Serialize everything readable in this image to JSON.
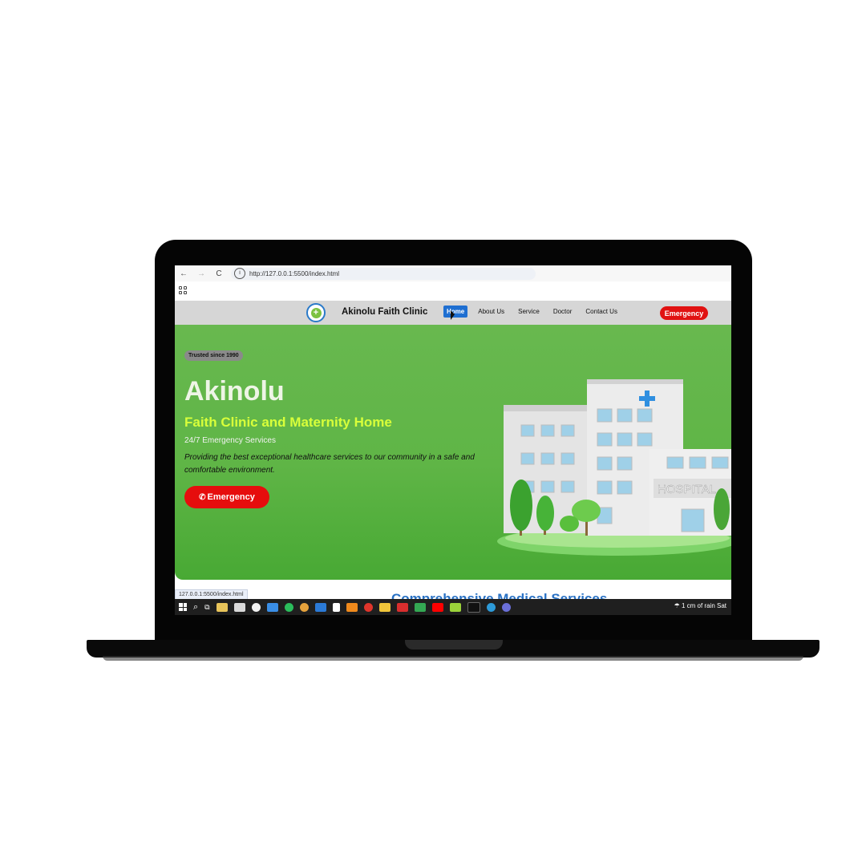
{
  "browser": {
    "back": "←",
    "forward": "→",
    "reload": "C",
    "url": "http://127.0.0.1:5500/index.html",
    "status_url": "127.0.0.1:5500/index.html"
  },
  "header": {
    "brand": "Akinolu Faith Clinic",
    "nav": [
      "Home",
      "About Us",
      "Service",
      "Doctor",
      "Contact Us"
    ],
    "active_nav": "Home",
    "emergency_label": "Emergency"
  },
  "hero": {
    "badge": "Trusted since 1990",
    "title": "Akinolu",
    "subtitle": "Faith Clinic and Maternity Home",
    "tagline": "24/7 Emergency Services",
    "description": "Providing the best exceptional healthcare services to our community in a safe and comfortable environment.",
    "button_label": "Emergency",
    "building_sign": "HOSPITAL"
  },
  "section_peek": "Comprehensive Medical Services",
  "taskbar": {
    "weather": "1 cm of rain Sat"
  },
  "colors": {
    "hero_green": "#5fb546",
    "emergency_red": "#e11212",
    "accent_yellow": "#d8ff3a",
    "nav_active": "#1f6fd1"
  }
}
